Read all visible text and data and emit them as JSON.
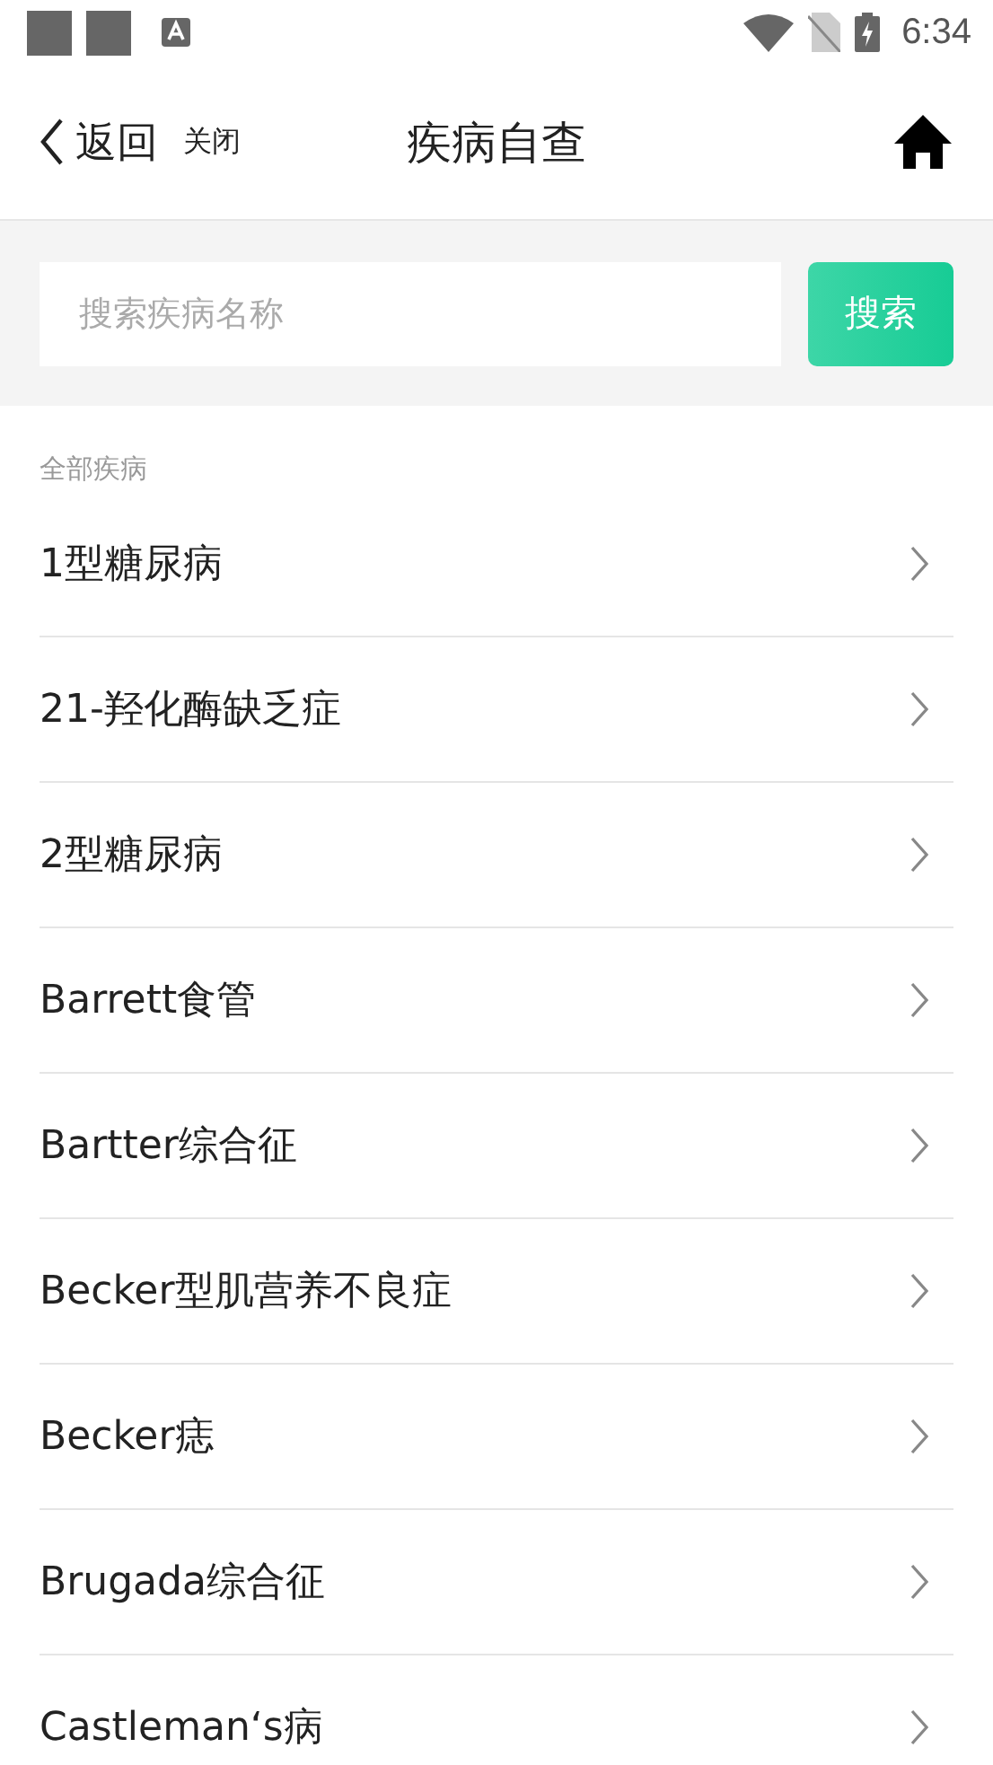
{
  "status_bar": {
    "time": "6:34"
  },
  "header": {
    "back": "返回",
    "close": "关闭",
    "title": "疾病自查"
  },
  "search": {
    "placeholder": "搜索疾病名称",
    "button": "搜索"
  },
  "section": {
    "label": "全部疾病"
  },
  "items": [
    {
      "name": "1型糖尿病"
    },
    {
      "name": "21-羟化酶缺乏症"
    },
    {
      "name": "2型糖尿病"
    },
    {
      "name": "Barrett食管"
    },
    {
      "name": "Bartter综合征"
    },
    {
      "name": "Becker型肌营养不良症"
    },
    {
      "name": "Becker痣"
    },
    {
      "name": "Brugada综合征"
    },
    {
      "name": "Castleman‘s病"
    }
  ]
}
